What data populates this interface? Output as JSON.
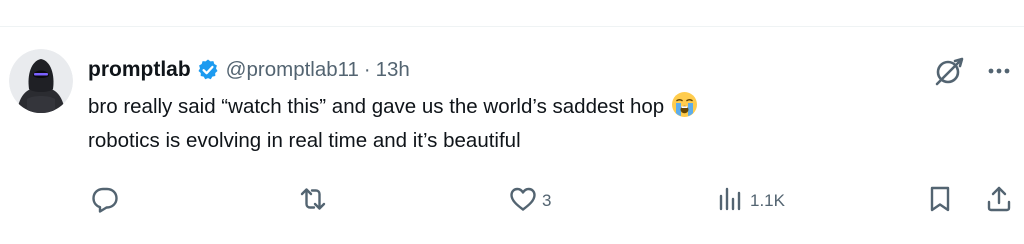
{
  "author": {
    "display_name": "promptlab",
    "handle": "@promptlab11",
    "separator": "·",
    "time": "13h",
    "verified": true
  },
  "tweet": {
    "line1": "bro really said “watch this” and gave us the world’s saddest hop",
    "line1_emoji": "loudly-crying-face",
    "line2": "robotics is evolving in real time and it’s beautiful"
  },
  "actions": {
    "replies": "",
    "reposts": "",
    "likes": "3",
    "views": "1.1K"
  },
  "icons": {
    "top_right": [
      "grok-icon",
      "more-icon"
    ],
    "action_bar": [
      "reply-icon",
      "repost-icon",
      "like-icon",
      "views-icon",
      "bookmark-icon",
      "share-icon"
    ]
  },
  "colors": {
    "text_primary": "#0f1419",
    "text_secondary": "#536471",
    "verified_badge": "#1d9bf0",
    "divider": "#eff3f4"
  }
}
